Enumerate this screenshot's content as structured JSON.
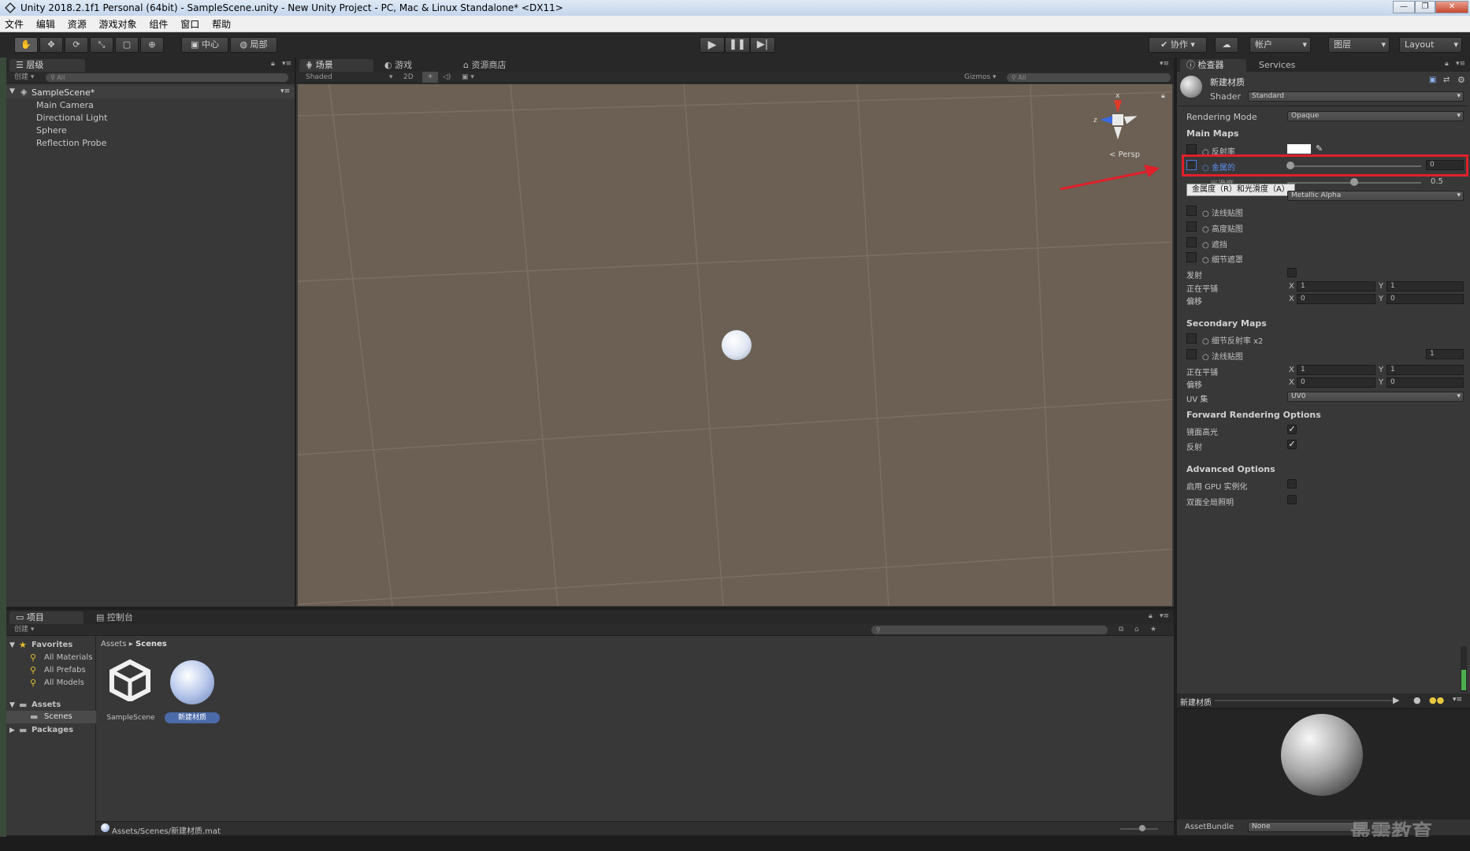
{
  "window": {
    "title": "Unity 2018.2.1f1 Personal (64bit) - SampleScene.unity - New Unity Project - PC, Mac & Linux Standalone* <DX11>",
    "buttons": [
      "—",
      "❐",
      "✕"
    ]
  },
  "menu": [
    "文件",
    "编辑",
    "资源",
    "游戏对象",
    "组件",
    "窗口",
    "帮助"
  ],
  "toolbar": {
    "pivot": "中心",
    "space": "局部",
    "collab": "协作",
    "account": "帐户",
    "layers": "图层",
    "layout": "Layout"
  },
  "hierarchy": {
    "tab": "层级",
    "create": "创建",
    "search_placeholder": "All",
    "scene": "SampleScene*",
    "items": [
      "Main Camera",
      "Directional Light",
      "Sphere",
      "Reflection Probe"
    ]
  },
  "scene_view": {
    "tabs": [
      "场景",
      "游戏",
      "资源商店"
    ],
    "shading": "Shaded",
    "mode_2d": "2D",
    "gizmos": "Gizmos",
    "search_placeholder": "All",
    "persp": "Persp",
    "axis_x": "x",
    "axis_z": "z"
  },
  "inspector": {
    "tabs": [
      "检查器",
      "Services"
    ],
    "material_name": "新建材质",
    "shader_label": "Shader",
    "shader_value": "Standard",
    "rendering_mode_label": "Rendering Mode",
    "rendering_mode_value": "Opaque",
    "main_maps": "Main Maps",
    "albedo": "反射率",
    "metallic": "金属的",
    "metallic_value": "0",
    "smoothness_label": "光滑度",
    "smoothness_value": "0.5",
    "tooltip": "金属度（R）和光滑度（A）",
    "source_value": "Metallic Alpha",
    "normal_map": "法线贴图",
    "height_map": "高度贴图",
    "occlusion": "遮挡",
    "detail_mask": "细节遮罩",
    "emission": "发射",
    "tiling": "正在平铺",
    "offset": "偏移",
    "tiling_x": "1",
    "tiling_y": "1",
    "offset_x": "0",
    "offset_y": "0",
    "secondary_maps": "Secondary Maps",
    "detail_albedo": "细节反射率 x2",
    "sec_normal_map": "法线贴图",
    "sec_normal_value": "1",
    "sec_tiling_x": "1",
    "sec_tiling_y": "1",
    "sec_offset_x": "0",
    "sec_offset_y": "0",
    "uv_set_label": "UV 集",
    "uv_set_value": "UV0",
    "forward_options": "Forward Rendering Options",
    "specular": "镜面高光",
    "reflections": "反射",
    "advanced_options": "Advanced Options",
    "gpu_instancing": "启用 GPU 实例化",
    "double_sided_gi": "双面全局照明",
    "x_label": "X",
    "y_label": "Y",
    "preview_title": "新建材质",
    "assetbundle_label": "AssetBundle",
    "assetbundle_value": "None",
    "watermark": "最需教育"
  },
  "project": {
    "tabs": [
      "项目",
      "控制台"
    ],
    "create": "创建",
    "favorites": "Favorites",
    "fav_items": [
      "All Materials",
      "All Prefabs",
      "All Models"
    ],
    "assets": "Assets",
    "scenes": "Scenes",
    "packages": "Packages",
    "breadcrumb": [
      "Assets",
      "Scenes"
    ],
    "files": [
      "SampleScene",
      "新建材质"
    ],
    "status_path": "Assets/Scenes/新建材质.mat"
  },
  "colors": {
    "highlight_box": "#e0202a",
    "arrow": "#e0202a",
    "selection": "#3e7ad8",
    "scene_bg": "#6b6053"
  }
}
